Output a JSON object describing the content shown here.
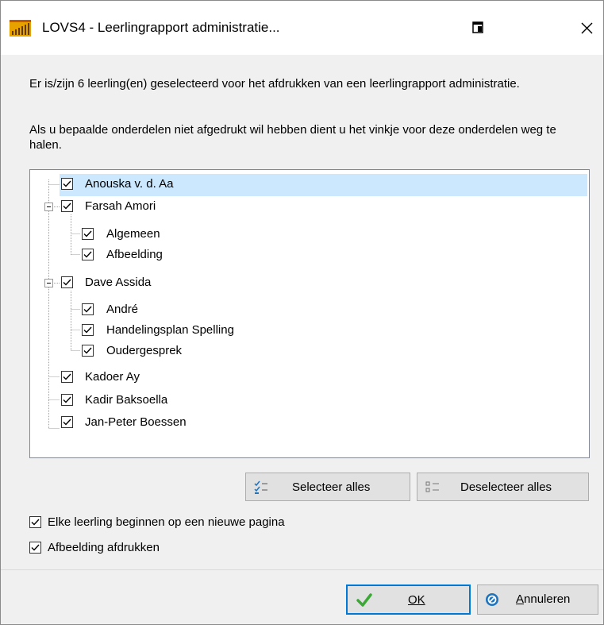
{
  "window": {
    "title": "LOVS4 - Leerlingrapport administratie...",
    "icons": {
      "app": "bar-chart-app-icon",
      "restore": "restore-window-icon",
      "close": "close-icon"
    }
  },
  "description": {
    "line1": "Er is/zijn 6 leerling(en) geselecteerd voor het afdrukken van een leerlingrapport administratie.",
    "line2": "Als u bepaalde onderdelen niet afgedrukt wil hebben dient u het vinkje voor deze onderdelen weg te halen."
  },
  "tree": {
    "students": [
      {
        "name": "Anouska v. d. Aa",
        "checked": true,
        "selected": true,
        "children": []
      },
      {
        "name": "Farsah Amori",
        "checked": true,
        "expanded": true,
        "children": [
          {
            "name": "Algemeen",
            "checked": true
          },
          {
            "name": "Afbeelding",
            "checked": true
          }
        ]
      },
      {
        "name": "Dave Assida",
        "checked": true,
        "expanded": true,
        "children": [
          {
            "name": "André",
            "checked": true
          },
          {
            "name": "Handelingsplan Spelling",
            "checked": true
          },
          {
            "name": "Oudergesprek",
            "checked": true
          }
        ]
      },
      {
        "name": "Kadoer Ay",
        "checked": true,
        "children": []
      },
      {
        "name": "Kadir Baksoella",
        "checked": true,
        "children": []
      },
      {
        "name": "Jan-Peter Boessen",
        "checked": true,
        "children": []
      }
    ]
  },
  "buttons": {
    "select_all": "Selecteer alles",
    "deselect_all": "Deselecteer alles",
    "ok": "OK",
    "cancel": "Annuleren",
    "icons": {
      "select_all": "checklist-icon",
      "deselect_all": "unchecked-list-icon",
      "ok": "green-checkmark-icon",
      "cancel": "blue-cancel-icon"
    }
  },
  "options": {
    "new_page": {
      "label": "Elke leerling beginnen op een nieuwe pagina",
      "checked": true
    },
    "print_image": {
      "label": "Afbeelding afdrukken",
      "checked": true
    }
  },
  "colors": {
    "selection": "#cce8ff",
    "default_button_border": "#0078d7",
    "ok_check": "#3aaa35",
    "cancel_icon": "#1e73be"
  }
}
